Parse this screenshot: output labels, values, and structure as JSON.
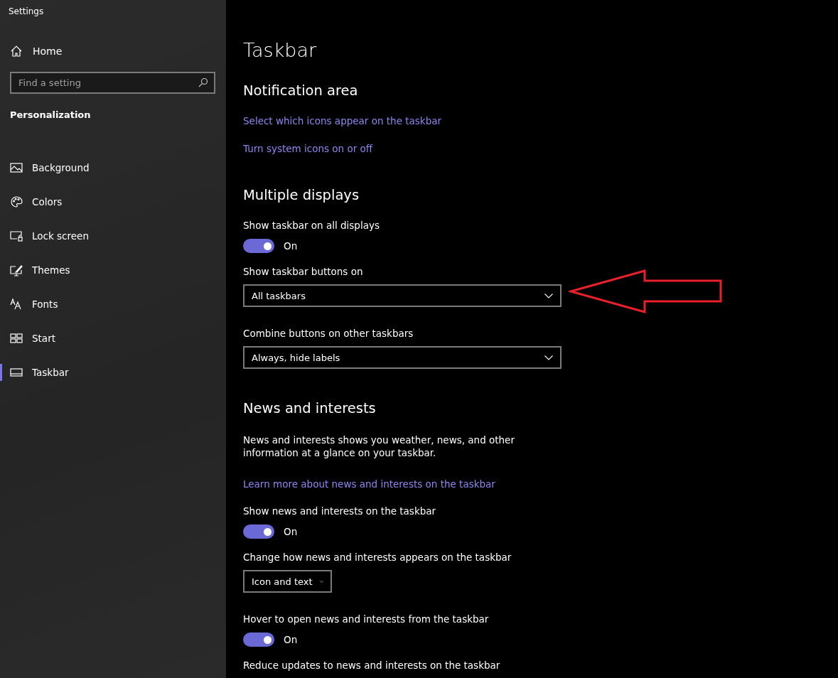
{
  "window": {
    "title": "Settings"
  },
  "sidebar": {
    "home": "Home",
    "search": {
      "placeholder": "Find a setting"
    },
    "group": "Personalization",
    "items": [
      {
        "label": "Background",
        "selected": false
      },
      {
        "label": "Colors",
        "selected": false
      },
      {
        "label": "Lock screen",
        "selected": false
      },
      {
        "label": "Themes",
        "selected": false
      },
      {
        "label": "Fonts",
        "selected": false
      },
      {
        "label": "Start",
        "selected": false
      },
      {
        "label": "Taskbar",
        "selected": true
      }
    ]
  },
  "page": {
    "title": "Taskbar",
    "sections": [
      {
        "heading": "Notification area",
        "items": [
          {
            "kind": "link",
            "text": "Select which icons appear on the taskbar"
          },
          {
            "kind": "link",
            "text": "Turn system icons on or off"
          }
        ]
      },
      {
        "heading": "Multiple displays",
        "items": [
          {
            "kind": "label",
            "text": "Show taskbar on all displays"
          },
          {
            "kind": "toggle",
            "on": true,
            "text": "On"
          },
          {
            "kind": "label",
            "text": "Show taskbar buttons on"
          },
          {
            "kind": "dropdown",
            "value": "All taskbars",
            "wide": true
          },
          {
            "kind": "label",
            "text": "Combine buttons on other taskbars"
          },
          {
            "kind": "dropdown",
            "value": "Always, hide labels",
            "wide": true
          }
        ]
      },
      {
        "heading": "News and interests",
        "items": [
          {
            "kind": "paragraph",
            "text": "News and interests shows you weather, news, and other information at a glance on your taskbar."
          },
          {
            "kind": "link",
            "text": "Learn more about news and interests on the taskbar"
          },
          {
            "kind": "label",
            "text": "Show news and interests on the taskbar"
          },
          {
            "kind": "toggle",
            "on": true,
            "text": "On"
          },
          {
            "kind": "label",
            "text": "Change how news and interests appears on the taskbar"
          },
          {
            "kind": "dropdown",
            "value": "Icon and text",
            "wide": false
          },
          {
            "kind": "label",
            "text": "Hover to open news and interests from the taskbar"
          },
          {
            "kind": "toggle",
            "on": true,
            "text": "On"
          },
          {
            "kind": "label",
            "text": "Reduce updates to news and interests on the taskbar"
          }
        ]
      }
    ]
  }
}
